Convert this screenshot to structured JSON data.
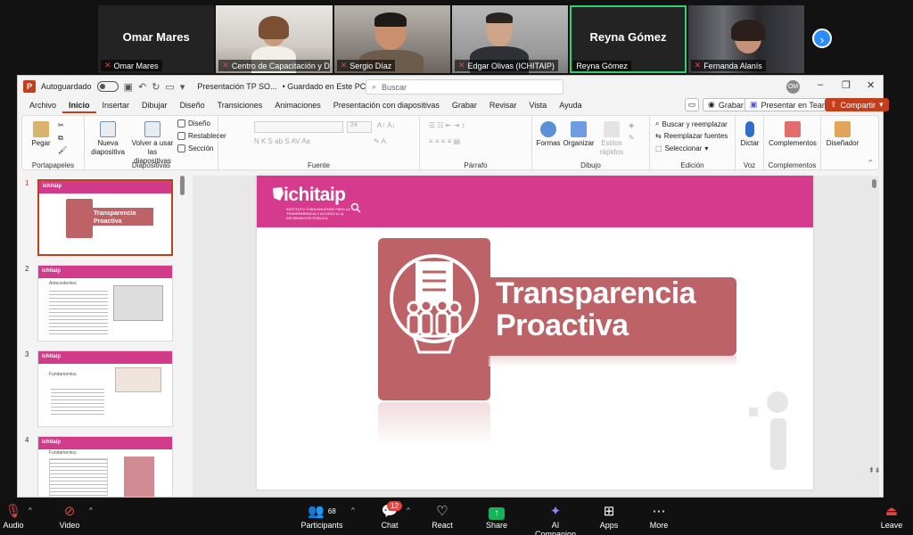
{
  "participants": [
    {
      "big_name": "Omar Mares",
      "label": "Omar Mares",
      "video": false
    },
    {
      "big_name": "",
      "label": "Centro de Capacitación y De...",
      "video": true
    },
    {
      "big_name": "",
      "label": "Sergio Díaz",
      "video": true
    },
    {
      "big_name": "",
      "label": "Edgar Olivas (ICHITAIP)",
      "video": true
    },
    {
      "big_name": "Reyna Gómez",
      "label": "Reyna Gómez",
      "video": false,
      "active": true
    },
    {
      "big_name": "",
      "label": "Fernanda Alanís",
      "video": true
    }
  ],
  "ppt": {
    "autosave_label": "Autoguardado",
    "doc_title": "Presentación TP SO...",
    "save_status": "• Guardado en Este PC",
    "search_placeholder": "Buscar",
    "user_initials": "OM",
    "menu": [
      "Archivo",
      "Inicio",
      "Insertar",
      "Dibujar",
      "Diseño",
      "Transiciones",
      "Animaciones",
      "Presentación con diapositivas",
      "Grabar",
      "Revisar",
      "Vista",
      "Ayuda"
    ],
    "active_menu": "Inicio",
    "record_btn": "Grabar",
    "teams_btn": "Presentar en Teams",
    "share_btn": "Compartir",
    "ribbon": {
      "paste": "Pegar",
      "clipboard_group": "Portapapeles",
      "new_slide": "Nueva diapositiva",
      "reuse_slides": "Volver a usar las diapositivas",
      "layout": "Diseño",
      "reset": "Restablecer",
      "section": "Sección",
      "slides_group": "Diapositivas",
      "font_group": "Fuente",
      "font_size": "24",
      "paragraph_group": "Párrafo",
      "shapes": "Formas",
      "arrange": "Organizar",
      "quick_styles": "Estilos rápidos",
      "drawing_group": "Dibujo",
      "find": "Buscar y reemplazar",
      "replace": "Reemplazar fuentes",
      "select": "Seleccionar",
      "editing_group": "Edición",
      "dictate": "Dictar",
      "voice_group": "Voz",
      "addins": "Complementos",
      "addins_group": "Complementos",
      "designer": "Diseñador"
    },
    "thumbnails": [
      {
        "num": "1",
        "title": "Transparencia Proactiva",
        "selected": true
      },
      {
        "num": "2",
        "title": "Antecedentes",
        "selected": false
      },
      {
        "num": "3",
        "title": "Fundamentos",
        "selected": false
      },
      {
        "num": "4",
        "title": "Fundamentos",
        "selected": false
      }
    ],
    "thumb_logo": "ichitaip",
    "slide": {
      "logo": "ichitaip",
      "logo_sub": "INSTITUTO CHIHUAHUENSE PARA LA TRANSPARENCIA Y ACCESO A LA INFORMACIÓN PÚBLICA",
      "title_line1": "Transparencia",
      "title_line2": "Proactiva"
    }
  },
  "zoom_bar": {
    "audio": "Audio",
    "video": "Video",
    "participants": "Participants",
    "participant_count": "68",
    "chat": "Chat",
    "chat_badge": "12",
    "react": "React",
    "share": "Share",
    "ai": "AI Companion",
    "apps": "Apps",
    "more": "More",
    "leave": "Leave"
  },
  "colors": {
    "brand_pink": "#d53a8c",
    "badge_rose": "#bd6266",
    "ppt_accent": "#c43e1c",
    "zoom_blue": "#2d8cff",
    "active_speaker": "#2fd26c"
  }
}
